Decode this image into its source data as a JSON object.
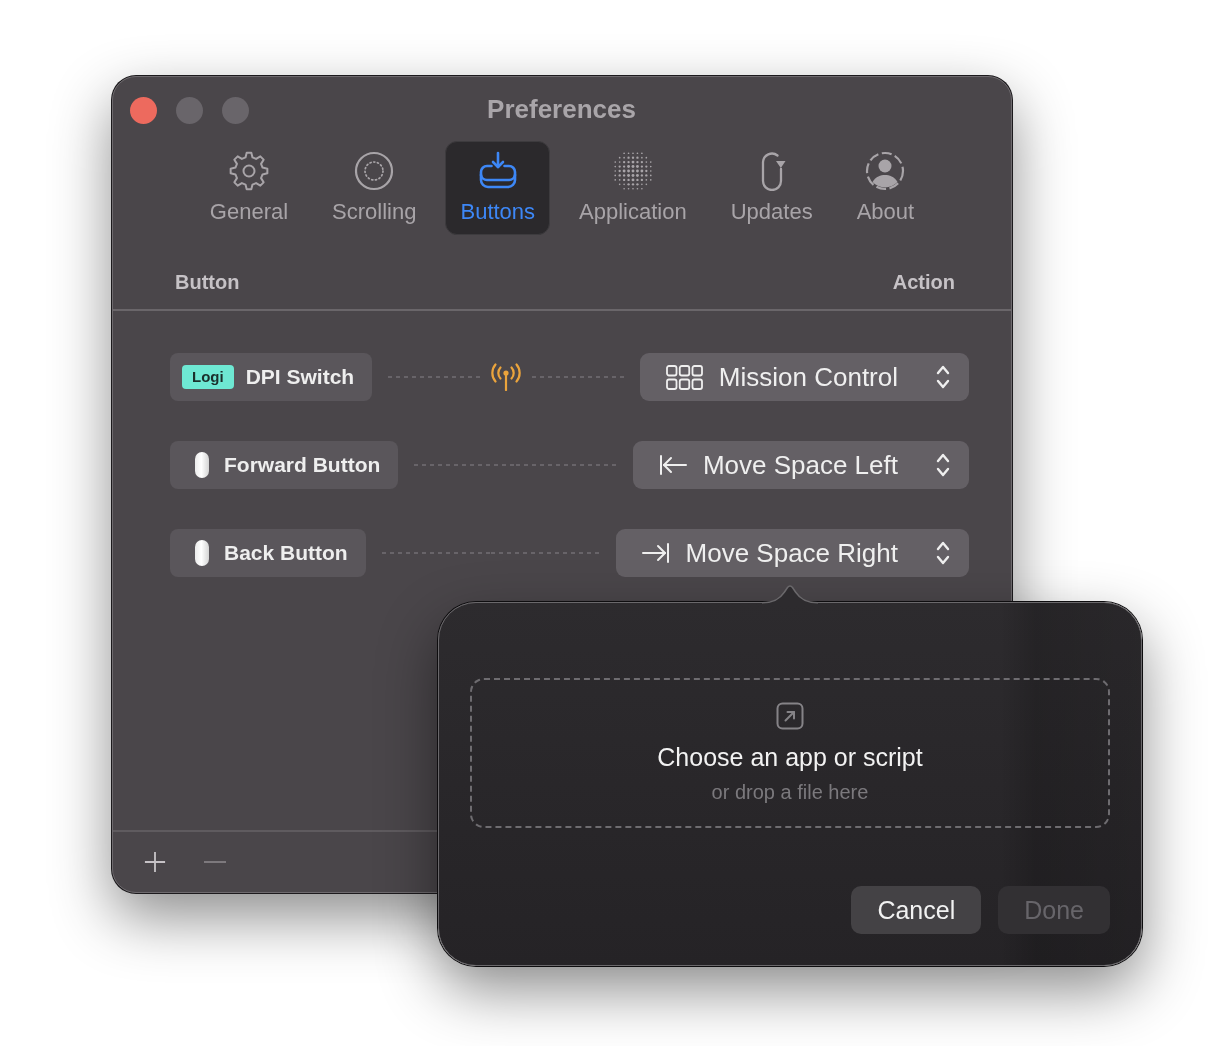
{
  "window": {
    "title": "Preferences",
    "controls": [
      {
        "color": "#ed6a5e"
      },
      {
        "color": "#69656a"
      },
      {
        "color": "#69656a"
      }
    ]
  },
  "tabs": [
    {
      "label": "General",
      "selected": false
    },
    {
      "label": "Scrolling",
      "selected": false
    },
    {
      "label": "Buttons",
      "selected": true
    },
    {
      "label": "Application",
      "selected": false
    },
    {
      "label": "Updates",
      "selected": false
    },
    {
      "label": "About",
      "selected": false
    }
  ],
  "columns": [
    "Button",
    "Action"
  ],
  "mappings": [
    {
      "button": {
        "badge": "Logi",
        "label": "DPI Switch"
      },
      "signal": true,
      "action": {
        "kind": "mission-control",
        "label": "Mission Control"
      }
    },
    {
      "button": {
        "label": "Forward Button"
      },
      "signal": false,
      "action": {
        "kind": "move-left",
        "label": "Move Space Left"
      }
    },
    {
      "button": {
        "label": "Back Button"
      },
      "signal": false,
      "action": {
        "kind": "move-right",
        "label": "Move Space Right"
      }
    }
  ],
  "footer": {
    "add_button": {
      "disabled": false
    },
    "remove_button": {
      "disabled": true
    }
  },
  "popover": {
    "title": "Choose an app or script",
    "hint": "or drop a file here",
    "buttons": [
      {
        "label": "Cancel",
        "disabled": false
      },
      {
        "label": "Done",
        "disabled": true
      }
    ]
  }
}
